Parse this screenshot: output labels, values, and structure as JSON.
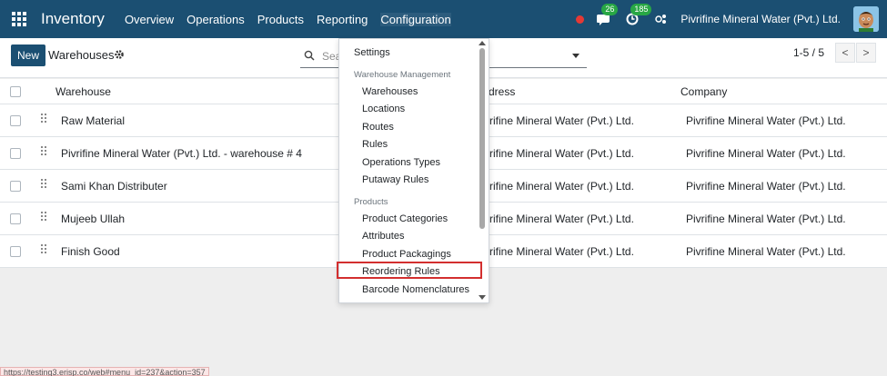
{
  "navbar": {
    "app_name": "Inventory",
    "menus": [
      "Overview",
      "Operations",
      "Products",
      "Reporting",
      "Configuration"
    ],
    "messages_count": "26",
    "activities_count": "185",
    "company": "Pivrifine Mineral Water (Pvt.) Ltd."
  },
  "control_panel": {
    "new_label": "New",
    "title": "Warehouses",
    "search_placeholder": "Sear",
    "pager_value": "1-5 / 5",
    "pager_prev": "<",
    "pager_next": ">"
  },
  "table": {
    "columns": [
      "Warehouse",
      "dress",
      "Company"
    ],
    "rows": [
      {
        "warehouse": "Raw Material",
        "address": "vrifine Mineral Water (Pvt.) Ltd.",
        "company": "Pivrifine Mineral Water (Pvt.) Ltd."
      },
      {
        "warehouse": "Pivrifine Mineral Water (Pvt.) Ltd. - warehouse # 4",
        "address": "vrifine Mineral Water (Pvt.) Ltd.",
        "company": "Pivrifine Mineral Water (Pvt.) Ltd."
      },
      {
        "warehouse": "Sami Khan Distributer",
        "address": "vrifine Mineral Water (Pvt.) Ltd.",
        "company": "Pivrifine Mineral Water (Pvt.) Ltd."
      },
      {
        "warehouse": "Mujeeb Ullah",
        "address": "vrifine Mineral Water (Pvt.) Ltd.",
        "company": "Pivrifine Mineral Water (Pvt.) Ltd."
      },
      {
        "warehouse": "Finish Good",
        "address": "vrifine Mineral Water (Pvt.) Ltd.",
        "company": "Pivrifine Mineral Water (Pvt.) Ltd."
      }
    ]
  },
  "dropdown": {
    "settings": "Settings",
    "section_warehouse": "Warehouse Management",
    "warehouse_items": [
      "Warehouses",
      "Locations",
      "Routes",
      "Rules",
      "Operations Types",
      "Putaway Rules"
    ],
    "section_products": "Products",
    "product_items": [
      "Product Categories",
      "Attributes",
      "Product Packagings",
      "Reordering Rules",
      "Barcode Nomenclatures"
    ]
  },
  "status_url": "https://testing3.erisp.co/web#menu_id=237&action=357",
  "colors": {
    "navbar": "#1b4f72",
    "highlight_border": "#d32f2f",
    "badge": "#28a745"
  }
}
